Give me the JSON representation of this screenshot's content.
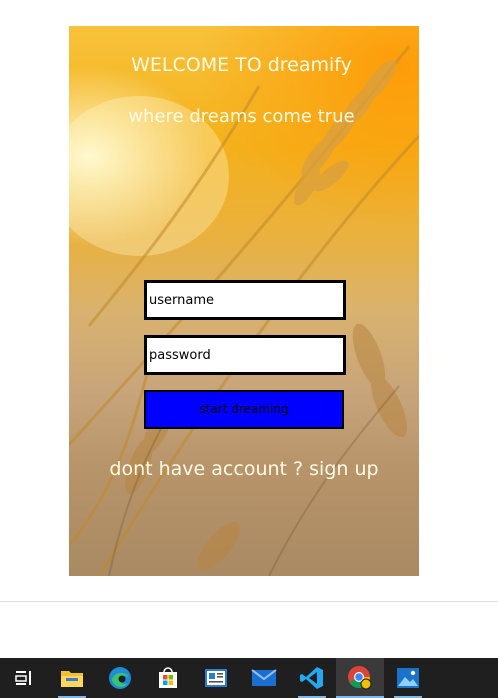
{
  "login": {
    "title": "WELCOME TO dreamify",
    "tagline": "where dreams come true",
    "username_placeholder": "username",
    "password_placeholder": "password",
    "submit_label": "start dreaming",
    "signup_prefix": "dont have account ? ",
    "signup_link": "sign up"
  },
  "colors": {
    "submit_bg": "#0000ff",
    "field_border": "#000000",
    "text_light": "#fffbe6",
    "taskbar_bg": "#1f1f1f"
  },
  "taskbar": {
    "items": [
      {
        "name": "task-view-icon"
      },
      {
        "name": "file-explorer-icon"
      },
      {
        "name": "edge-icon"
      },
      {
        "name": "store-icon"
      },
      {
        "name": "news-icon"
      },
      {
        "name": "mail-icon"
      },
      {
        "name": "vscode-icon"
      },
      {
        "name": "chrome-icon",
        "active": true
      },
      {
        "name": "photos-icon"
      }
    ]
  }
}
